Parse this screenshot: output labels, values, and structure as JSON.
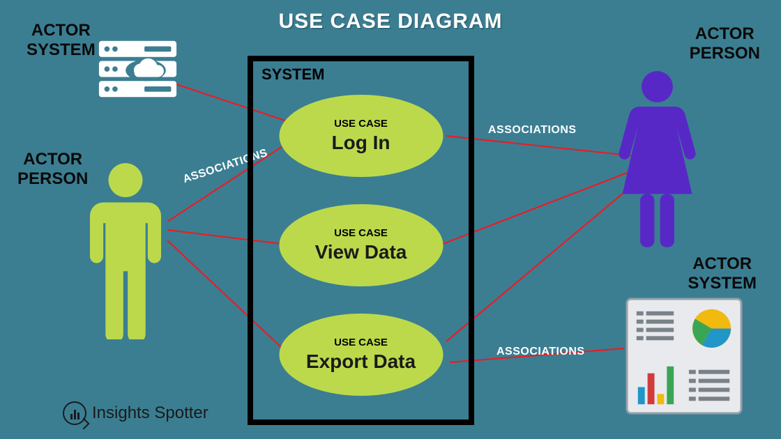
{
  "title": "USE CASE DIAGRAM",
  "system_label": "SYSTEM",
  "usecase_label": "USE CASE",
  "usecases": {
    "uc1": "Log In",
    "uc2": "View Data",
    "uc3": "Export Data"
  },
  "actors": {
    "system_tl": "ACTOR\nSYSTEM",
    "person_l": "ACTOR\nPERSON",
    "person_r": "ACTOR\nPERSON",
    "system_br": "ACTOR\nSYSTEM"
  },
  "assoc_label": "ASSOCIATIONS",
  "brand": "Insights Spotter",
  "colors": {
    "bg": "#3b7e92",
    "usecase": "#bcd94c",
    "person_left": "#bcd94c",
    "person_right": "#5828c7",
    "line": "#e61e25"
  }
}
